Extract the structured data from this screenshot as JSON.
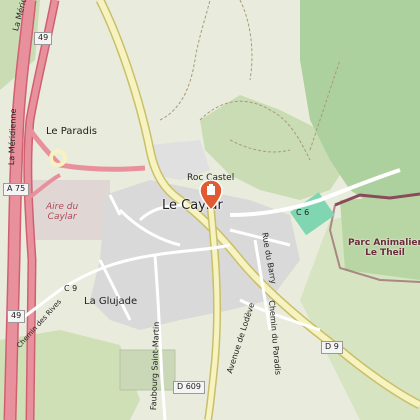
{
  "map": {
    "places": {
      "town": "Le Caylar",
      "le_paradis": "Le Paradis",
      "roc_castel": "Roc Castel",
      "la_glujade": "La Glujade"
    },
    "aire": [
      "Aire du",
      "Caylar"
    ],
    "park": [
      "Parc Animalier",
      "Le Theil"
    ],
    "roads": {
      "a75_shield": "A 75",
      "n49_top": "49",
      "n49_bottom": "49",
      "la_meridienne_top": "La Méridienne",
      "la_meridienne_left": "La Méridienne",
      "chemin_des_rives": "Chemin des Rives",
      "c9": "C 9",
      "faubourg": "Faubourg Saint-Martin",
      "avenue_lodeve": "Avenue de Lodève",
      "rue_du_barry": "Rue du Barry",
      "chemin_du_paradis": "Chemin du Paradis",
      "c6": "C 6",
      "d9_shield": "D 9",
      "d609_shield": "D 609"
    },
    "marker_icon": "map-pin-icon",
    "colors": {
      "motorway": "#e8909c",
      "motorway_edge": "#d06070",
      "road": "#f7f3c0",
      "road_edge": "#c9bf6a",
      "residential": "#d9d9d9",
      "forest": "#add19e",
      "park": "#c8facc",
      "marker": "#e05a32"
    }
  }
}
